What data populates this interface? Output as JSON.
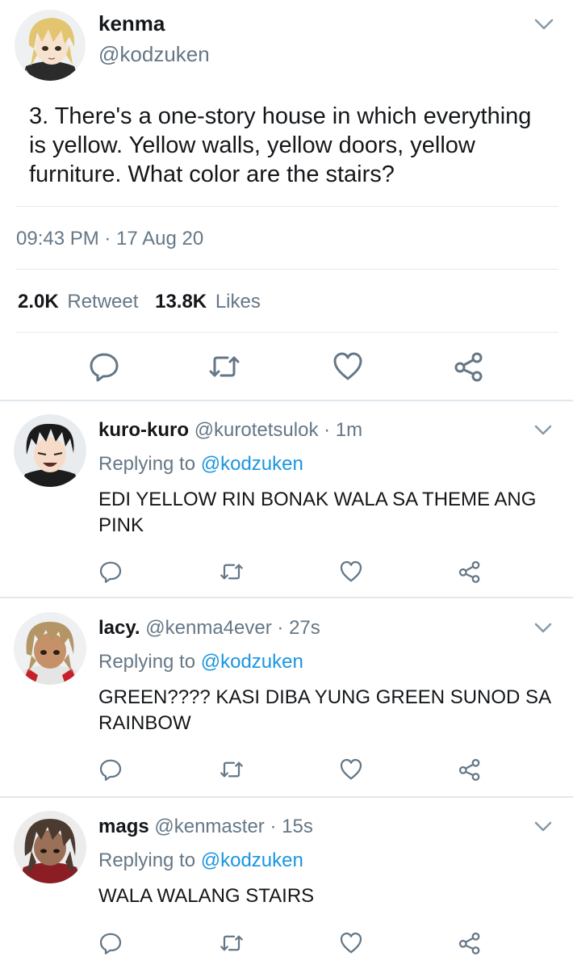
{
  "main_tweet": {
    "author_name": "kenma",
    "author_handle": "@kodzuken",
    "text": "3. There's a one-story house in which everything is yellow. Yellow walls, yellow doors, yellow furniture. What color are the stairs?",
    "timestamp": "09:43 PM · 17 Aug 20",
    "retweets_count": "2.0K",
    "retweets_label": "Retweet",
    "likes_count": "13.8K",
    "likes_label": "Likes",
    "avatar_icon": "kenma-avatar-icon"
  },
  "replies": [
    {
      "name": "kuro-kuro",
      "handle": "@kurotetsulok",
      "separator": "·",
      "time": "1m",
      "replying_label": "Replying to",
      "replying_to": "@kodzuken",
      "text": "EDI YELLOW RIN BONAK WALA SA THEME ANG PINK"
    },
    {
      "name": "lacy.",
      "handle": "@kenma4ever",
      "separator": "·",
      "time": "27s",
      "replying_label": "Replying to",
      "replying_to": "@kodzuken",
      "text": "GREEN???? KASI DIBA YUNG GREEN SUNOD SA RAINBOW"
    },
    {
      "name": "mags",
      "handle": "@kenmaster",
      "separator": "·",
      "time": "15s",
      "replying_label": "Replying to",
      "replying_to": "@kodzuken",
      "text": "WALA WALANG STAIRS"
    }
  ],
  "icons": [
    "chevron-down-icon",
    "reply-icon",
    "retweet-icon",
    "like-icon",
    "share-icon"
  ],
  "colors": {
    "text": "#14171a",
    "secondary": "#657786",
    "accent": "#1b95e0",
    "icon": "#657786",
    "divider": "#e6ecf0"
  }
}
